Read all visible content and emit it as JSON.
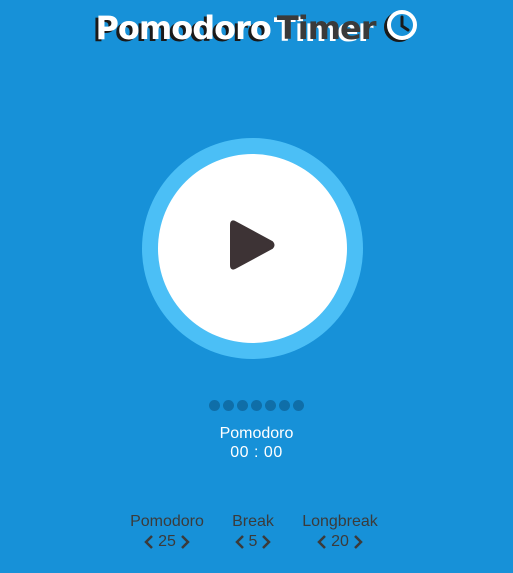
{
  "header": {
    "title_word1": "Pomodoro",
    "title_word2": "Timer",
    "icon": "clock-icon"
  },
  "timer": {
    "control_icon": "play-icon",
    "mode": "Pomodoro",
    "time": "00 : 00",
    "cycle_dots": 7
  },
  "settings": [
    {
      "label": "Pomodoro",
      "value": "25"
    },
    {
      "label": "Break",
      "value": "5"
    },
    {
      "label": "Longbreak",
      "value": "20"
    }
  ],
  "colors": {
    "background": "#1791d8",
    "ring": "#4bbff6",
    "face": "#ffffff",
    "play": "#3d3335",
    "dots": "#0f6ea8"
  }
}
